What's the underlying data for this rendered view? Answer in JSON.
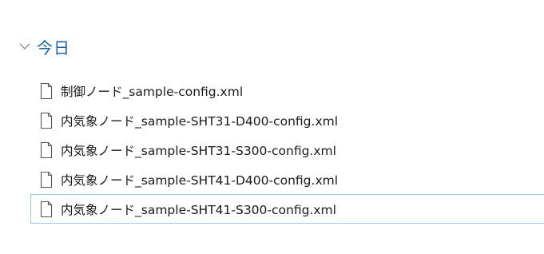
{
  "group": {
    "title": "今日",
    "collapse_icon": "chevron-down-icon"
  },
  "files": [
    {
      "name": "制御ノード_sample-config.xml",
      "icon": "document-icon",
      "selected": false
    },
    {
      "name": "内気象ノード_sample-SHT31-D400-config.xml",
      "icon": "document-icon",
      "selected": false
    },
    {
      "name": "内気象ノード_sample-SHT31-S300-config.xml",
      "icon": "document-icon",
      "selected": false
    },
    {
      "name": "内気象ノード_sample-SHT41-D400-config.xml",
      "icon": "document-icon",
      "selected": false
    },
    {
      "name": "内気象ノード_sample-SHT41-S300-config.xml",
      "icon": "document-icon",
      "selected": true
    }
  ],
  "colors": {
    "group_title": "#1c5fa8",
    "selection_border": "#9ec9ec",
    "icon_stroke": "#555555"
  }
}
